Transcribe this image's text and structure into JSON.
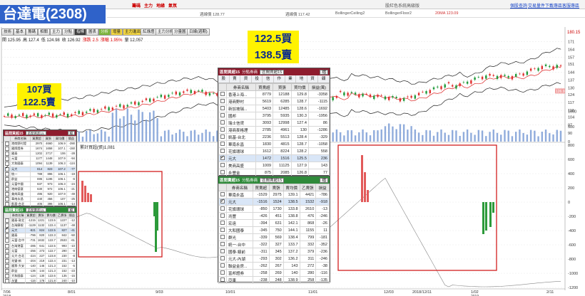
{
  "topbar": {
    "left_items": [
      "",
      "",
      "",
      "",
      "",
      "",
      "",
      "",
      "",
      "",
      "",
      "",
      "",
      ""
    ],
    "menu": [
      {
        "label": "籌碼",
        "red": true
      },
      {
        "label": "主力",
        "red": true
      },
      {
        "label": "地緣",
        "red": true
      },
      {
        "label": "氣氛",
        "red": true
      }
    ],
    "sub_items": [
      "",
      "",
      "",
      "",
      "",
      "",
      "",
      "",
      "",
      ""
    ],
    "tab_group": [
      "",
      "",
      "",
      "",
      "",
      "",
      "日K",
      "",
      "",
      "記錄"
    ],
    "center_text": "股紅色系統高級版",
    "right_links": [
      "個股查詢",
      "交易量件",
      "下載專區",
      "客服專區"
    ]
  },
  "title": "台達電(2308)",
  "legend": {
    "items": [
      {
        "text": "週線價 128.77",
        "red": false
      },
      {
        "text": "週線價 117.42",
        "red": false
      },
      {
        "text": "BollingerCeiling2",
        "red": false
      },
      {
        "text": "BollingerFloor2",
        "red": false
      },
      {
        "text": "20MA 123.09",
        "red": true
      }
    ]
  },
  "toolbar": {
    "buttons": [
      {
        "label": "技術",
        "style": ""
      },
      {
        "label": "基本",
        "style": ""
      },
      {
        "label": "籌碼",
        "style": ""
      },
      {
        "label": "相關",
        "style": ""
      },
      {
        "label": "主力",
        "style": ""
      },
      {
        "label": "分點",
        "style": ""
      },
      {
        "label": "指標",
        "style": "dark"
      },
      {
        "label": "圖表",
        "style": ""
      },
      {
        "label": "分析",
        "style": "green"
      },
      {
        "label": "增量",
        "style": "yellow"
      },
      {
        "label": "主力進出",
        "style": "yellow"
      },
      {
        "label": "紅綠燈",
        "style": ""
      },
      {
        "label": "主力分析",
        "style": ""
      },
      {
        "label": "分量圖",
        "style": ""
      },
      {
        "label": "日線(週期)",
        "style": ""
      }
    ]
  },
  "quote": {
    "items": [
      {
        "text": "開 125.95",
        "red": false
      },
      {
        "text": "高 127.4",
        "red": false
      },
      {
        "text": "低 124.98",
        "red": false
      },
      {
        "text": "收 126.92",
        "red": false
      },
      {
        "text": "漲跌 2.5",
        "red": true
      },
      {
        "text": "漲幅 1.95%",
        "red": true
      },
      {
        "text": "量 12,057",
        "red": false
      }
    ]
  },
  "annotations": {
    "left_buy": "107買",
    "left_sell": "122.5賣",
    "center_buy": "122.5買",
    "center_sell": "138.5賣"
  },
  "chart_data": {
    "type": "candlestick",
    "price_axis": {
      "max_label": "180.15",
      "ticks": [
        171,
        164,
        157,
        151,
        144,
        137,
        130,
        124,
        117,
        110,
        104,
        97,
        90
      ],
      "last_price_label": "126.9"
    },
    "volume_axis": {
      "ticks": [
        1000,
        500,
        0
      ]
    },
    "indicator": {
      "title": "累計買超(張)1,081",
      "ticks": [
        800,
        600,
        400,
        200,
        0,
        -200,
        -400,
        -600,
        -800,
        -1000,
        -1200
      ]
    },
    "x_labels": [
      {
        "label": "7/06",
        "sub": "2018"
      },
      {
        "label": "8/01",
        "sub": ""
      },
      {
        "label": "9/03",
        "sub": ""
      },
      {
        "label": "10/01",
        "sub": ""
      },
      {
        "label": "11/01",
        "sub": ""
      },
      {
        "label": "12/03",
        "sub": ""
      },
      {
        "label": "2018/12/11",
        "sub": ""
      },
      {
        "label": "1/02",
        "sub": "2019"
      },
      {
        "label": "2/11",
        "sub": ""
      }
    ]
  },
  "buy_panel": {
    "title": "區間買超15",
    "select": "分點券商",
    "period": "區間買超15",
    "button": "檔",
    "tabs": [
      "股",
      "賣",
      "資",
      "投",
      "信",
      "作",
      "業",
      "地",
      "資",
      "顧"
    ],
    "columns": [
      "券商名稱",
      "買賣超",
      "買張",
      "買均價",
      "損益(萬)"
    ],
    "rows": [
      {
        "name": "香港上海...",
        "net": "8779",
        "buy": "12188",
        "avg": "129.8",
        "pl": "-3358",
        "checked": false
      },
      {
        "name": "港商野村",
        "net": "5619",
        "buy": "6285",
        "avg": "128.7",
        "pl": "-1115",
        "checked": false
      },
      {
        "name": "新加坡瑞...",
        "net": "5403",
        "buy": "12485",
        "avg": "128.6",
        "pl": "-1692",
        "checked": false
      },
      {
        "name": "國邦",
        "net": "3795",
        "buy": "5935",
        "avg": "130.3",
        "pl": "-1956",
        "checked": false
      },
      {
        "name": "瑞士信貸",
        "net": "3093",
        "buy": "12998",
        "avg": "127.4",
        "pl": "86",
        "checked": false
      },
      {
        "name": "港商麥格理",
        "net": "2785",
        "buy": "4961",
        "avg": "130",
        "pl": "-1286",
        "checked": false
      },
      {
        "name": "凱基-台北",
        "net": "2236",
        "buy": "5513",
        "avg": "128.4",
        "pl": "-329",
        "checked": false
      },
      {
        "name": "華南永昌",
        "net": "1830",
        "buy": "4815",
        "avg": "128.7",
        "pl": "-1058",
        "checked": false
      },
      {
        "name": "花旗環球",
        "net": "1612",
        "buy": "8224",
        "avg": "128.2",
        "pl": "558",
        "checked": false
      },
      {
        "name": "元大",
        "net": "1472",
        "buy": "1516",
        "avg": "125.5",
        "pl": "236",
        "checked": true
      },
      {
        "name": "美商高盛",
        "net": "1009",
        "buy": "11125",
        "avg": "127.9",
        "pl": "143",
        "checked": false
      },
      {
        "name": "永豐金",
        "net": "875",
        "buy": "2085",
        "avg": "126.8",
        "pl": "77",
        "checked": false
      }
    ]
  },
  "sell_panel": {
    "title": "區間賣超15",
    "select": "分點券商",
    "period": "區間賣超15",
    "button": "檔",
    "columns": [
      "券商名稱",
      "買賣超",
      "賣張",
      "賣均價",
      "乙賣張",
      "損益"
    ],
    "rows": [
      {
        "name": "華南永昌",
        "net": "-1529",
        "sell": "2975",
        "avg": "139.1",
        "t": "4421",
        "pl": "-786",
        "checked": false
      },
      {
        "name": "元大",
        "net": "-1516",
        "sell": "1524",
        "avg": "138.5",
        "t": "1532",
        "pl": "-918",
        "checked": true
      },
      {
        "name": "花旗環球",
        "net": "-850",
        "sell": "1730",
        "avg": "133.8",
        "t": "2610",
        "pl": "-13",
        "checked": false
      },
      {
        "name": "兆豐",
        "net": "-426",
        "sell": "451",
        "avg": "138.8",
        "t": "476",
        "pl": "-246",
        "checked": false
      },
      {
        "name": "宏遠",
        "net": "-394",
        "sell": "631",
        "avg": "142.1",
        "t": "868",
        "pl": "-26",
        "checked": false
      },
      {
        "name": "大和國泰",
        "net": "-345",
        "sell": "750",
        "avg": "144.1",
        "t": "1155",
        "pl": "11",
        "checked": false
      },
      {
        "name": "群光",
        "net": "-339",
        "sell": "569",
        "avg": "138.4",
        "t": "799",
        "pl": "-181",
        "checked": false
      },
      {
        "name": "統一-台中",
        "net": "-322",
        "sell": "327",
        "avg": "133.7",
        "t": "332",
        "pl": "-352",
        "checked": false
      },
      {
        "name": "國泰-鎮前",
        "net": "-311",
        "sell": "345",
        "avg": "137.2",
        "t": "379",
        "pl": "-236",
        "checked": false
      },
      {
        "name": "元大-內湖",
        "net": "-293",
        "sell": "302",
        "avg": "136.2",
        "t": "311",
        "pl": "-246",
        "checked": false
      },
      {
        "name": "聯益金房...",
        "net": "-262",
        "sell": "267",
        "avg": "143",
        "t": "272",
        "pl": "-38",
        "checked": false
      },
      {
        "name": "富邦證券",
        "net": "-258",
        "sell": "269",
        "avg": "140",
        "t": "280",
        "pl": "-116",
        "checked": false
      },
      {
        "name": "亞東",
        "net": "-238",
        "sell": "248",
        "avg": "138.9",
        "t": "258",
        "pl": "-135",
        "checked": false
      }
    ]
  },
  "small_buy_panel": {
    "title": "區間買超15",
    "select": "區間買超15",
    "button": "檔",
    "columns": [
      "券商名稱",
      "買賣超",
      "買張",
      "買均價",
      "損益"
    ],
    "rows": [
      {
        "name": "港商野村證",
        "net": "2970",
        "buy": "4660",
        "avg": "106.9",
        "pl": "-390",
        "checked": false
      },
      {
        "name": "國際證券",
        "net": "1674",
        "buy": "1658",
        "avg": "107.1",
        "pl": "-150",
        "checked": false
      },
      {
        "name": "國泰",
        "net": "1202",
        "buy": "2717",
        "avg": "106",
        "pl": "-28",
        "checked": false
      },
      {
        "name": "元富",
        "net": "1177",
        "buy": "1448",
        "avg": "107.9",
        "pl": "-94",
        "checked": false
      },
      {
        "name": "大和國泰",
        "net": "1094",
        "buy": "1139",
        "avg": "106.3",
        "pl": "-124",
        "checked": false
      },
      {
        "name": "元大",
        "net": "814",
        "buy": "823",
        "avg": "107.2",
        "pl": "-77",
        "checked": true
      },
      {
        "name": "統一",
        "net": "789",
        "buy": "896",
        "avg": "106.1",
        "pl": "-19",
        "checked": false
      },
      {
        "name": "群益",
        "net": "695",
        "buy": "1196",
        "avg": "106.1",
        "pl": "-6",
        "checked": false
      },
      {
        "name": "元富中國",
        "net": "637",
        "buy": "973",
        "avg": "106.3",
        "pl": "-24",
        "checked": false
      },
      {
        "name": "港商德意",
        "net": "630",
        "buy": "972",
        "avg": "106.1",
        "pl": "-21",
        "checked": false
      },
      {
        "name": "美商高盛",
        "net": "495",
        "buy": "920",
        "avg": "107.9",
        "pl": "-49",
        "checked": false
      },
      {
        "name": "華南永昌",
        "net": "440",
        "buy": "456",
        "avg": "107",
        "pl": "-25",
        "checked": false
      },
      {
        "name": "凱基-台北",
        "net": "405",
        "buy": "396",
        "avg": "106.1",
        "pl": "-14",
        "checked": false
      }
    ]
  },
  "small_sell_panel": {
    "title": "區間賣超15",
    "select": "區間賣超15",
    "button": "檔",
    "columns": [
      "券商名稱",
      "買賣超",
      "賣張",
      "賣均價",
      "乙賣張",
      "損益"
    ],
    "rows": [
      {
        "name": "國泰-敦北",
        "net": "-1215",
        "sell": "1221",
        "avg": "123.5",
        "t": "1227",
        "pl": "-12",
        "checked": false
      },
      {
        "name": "台灣摩根",
        "net": "-1129",
        "sell": "1132",
        "avg": "122.4",
        "t": "1137",
        "pl": "-48",
        "checked": false
      },
      {
        "name": "元大",
        "net": "-821",
        "sell": "824",
        "avg": "122.5",
        "t": "827",
        "pl": "-41",
        "checked": true
      },
      {
        "name": "國泰",
        "net": "-796",
        "sell": "820",
        "avg": "122.3",
        "t": "842",
        "pl": "-50",
        "checked": false
      },
      {
        "name": "元富-台中",
        "net": "-731",
        "sell": "1632",
        "avg": "122.7",
        "t": "2533",
        "pl": "-61",
        "checked": false
      },
      {
        "name": "台灣港富",
        "net": "-285",
        "sell": "641",
        "avg": "122.5",
        "t": "993",
        "pl": "-10",
        "checked": false
      },
      {
        "name": "元富",
        "net": "-256",
        "sell": "273",
        "avg": "122.7",
        "t": "290",
        "pl": "-9",
        "checked": false
      },
      {
        "name": "元大-台北",
        "net": "-224",
        "sell": "227",
        "avg": "123.8",
        "t": "230",
        "pl": "-8",
        "checked": false
      },
      {
        "name": "兆豐-新",
        "net": "-204",
        "sell": "219",
        "avg": "122.4",
        "t": "231",
        "pl": "-13",
        "checked": false
      },
      {
        "name": "國票-大安",
        "net": "-140",
        "sell": "146",
        "avg": "121.3",
        "t": "152",
        "pl": "-5",
        "checked": false
      },
      {
        "name": "群益",
        "net": "-136",
        "sell": "144",
        "avg": "121.3",
        "t": "152",
        "pl": "-23",
        "checked": false
      },
      {
        "name": "大和國泰",
        "net": "-124",
        "sell": "130",
        "avg": "122.6",
        "t": "135",
        "pl": "-15",
        "checked": false
      },
      {
        "name": "永豐",
        "net": "-116",
        "sell": "178",
        "avg": "121.8",
        "t": "240",
        "pl": "-10",
        "checked": false
      }
    ]
  }
}
